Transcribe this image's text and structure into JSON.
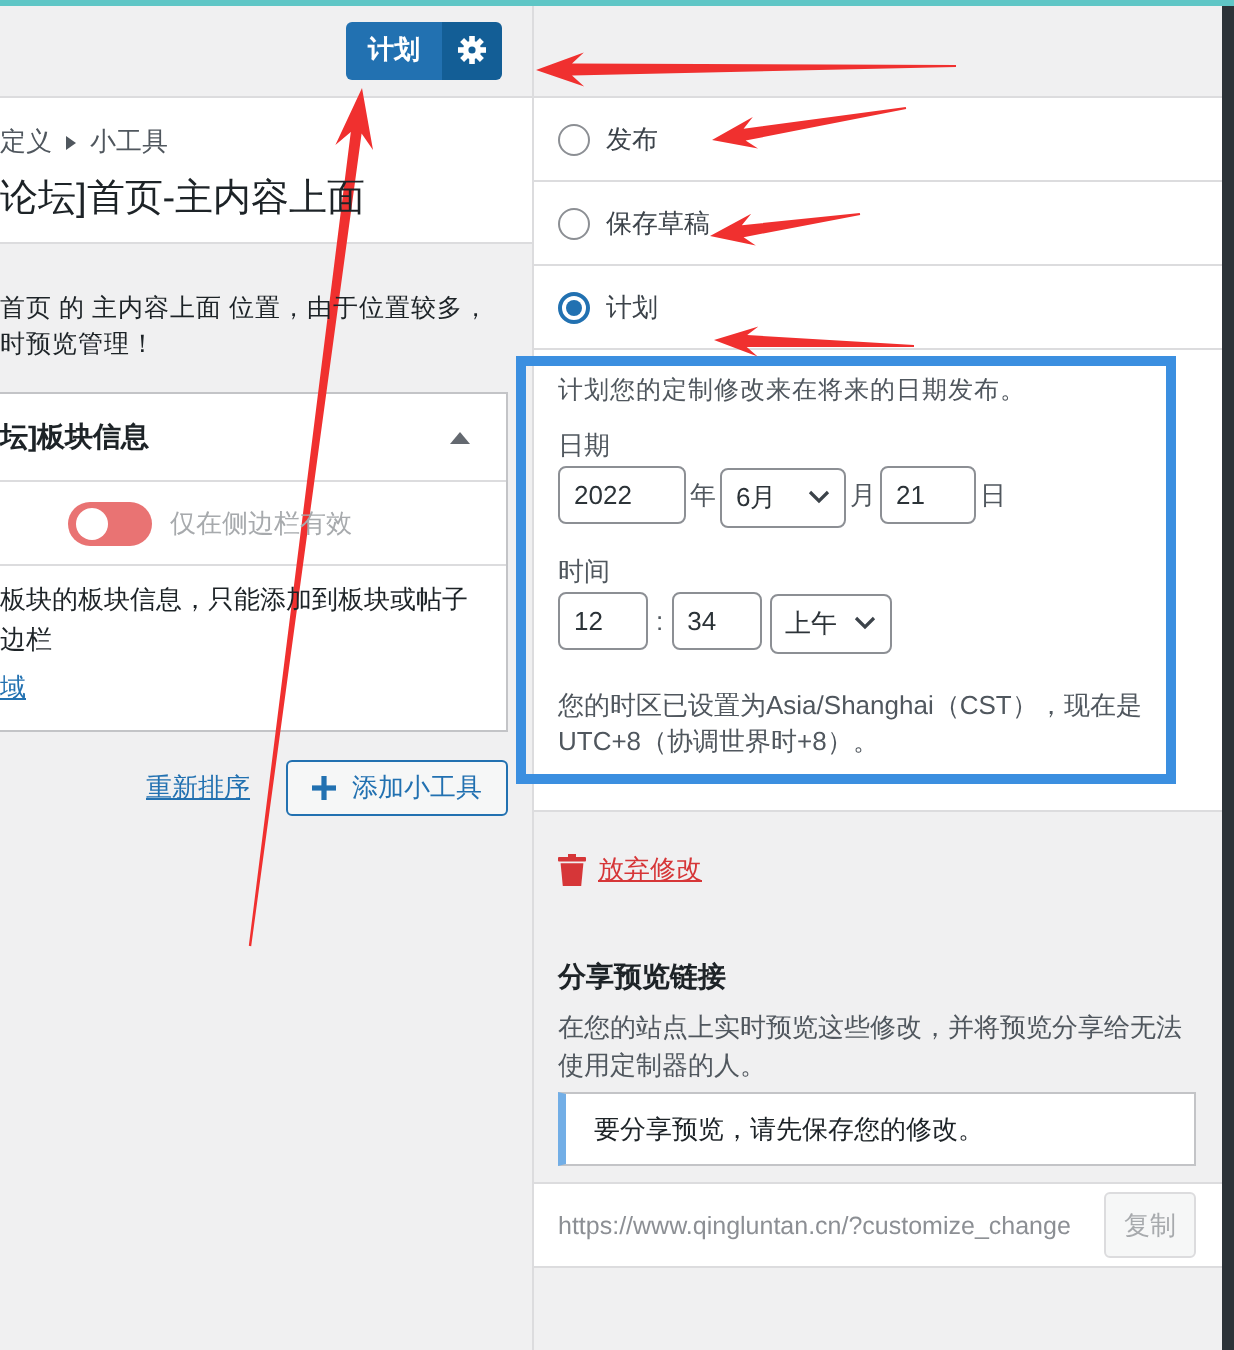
{
  "left_panel": {
    "schedule_button": "计划",
    "breadcrumb": [
      "定义",
      "小工具"
    ],
    "title": "论坛]首页-主内容上面",
    "description_lines": [
      "首页 的 主内容上面 位置，由于位置较多，",
      "时预览管理！"
    ],
    "widget": {
      "title": "坛]板块信息",
      "expanded": true,
      "toggle": {
        "label": "仅在侧边栏有效",
        "on": false
      },
      "description_lines": [
        "板块的板块信息，只能添加到板块或帖子",
        "边栏"
      ],
      "link": "域"
    },
    "reorder_link": "重新排序",
    "add_widget_button": "添加小工具"
  },
  "right_panel": {
    "publish_options": [
      {
        "label": "发布",
        "selected": false
      },
      {
        "label": "保存草稿",
        "selected": false
      },
      {
        "label": "计划",
        "selected": true
      }
    ],
    "schedule": {
      "intro": "计划您的定制修改来在将来的日期发布。",
      "date_label": "日期",
      "year": "2022",
      "year_unit": "年",
      "month": "6月",
      "month_unit": "月",
      "day": "21",
      "day_unit": "日",
      "time_label": "时间",
      "hour": "12",
      "time_separator": ":",
      "minute": "34",
      "meridiem": "上午",
      "timezone_note": "您的时区已设置为Asia/Shanghai（CST），现在是UTC+8（协调世界时+8）。"
    },
    "discard_link": "放弃修改",
    "share": {
      "title": "分享预览链接",
      "description": "在您的站点上实时预览这些修改，并将预览分享给无法使用定制器的人。",
      "notice": "要分享预览，请先保存您的修改。",
      "url": "https://www.qingluntan.cn/?customize_change",
      "copy_button": {
        "label": "复制",
        "disabled": true
      }
    }
  }
}
